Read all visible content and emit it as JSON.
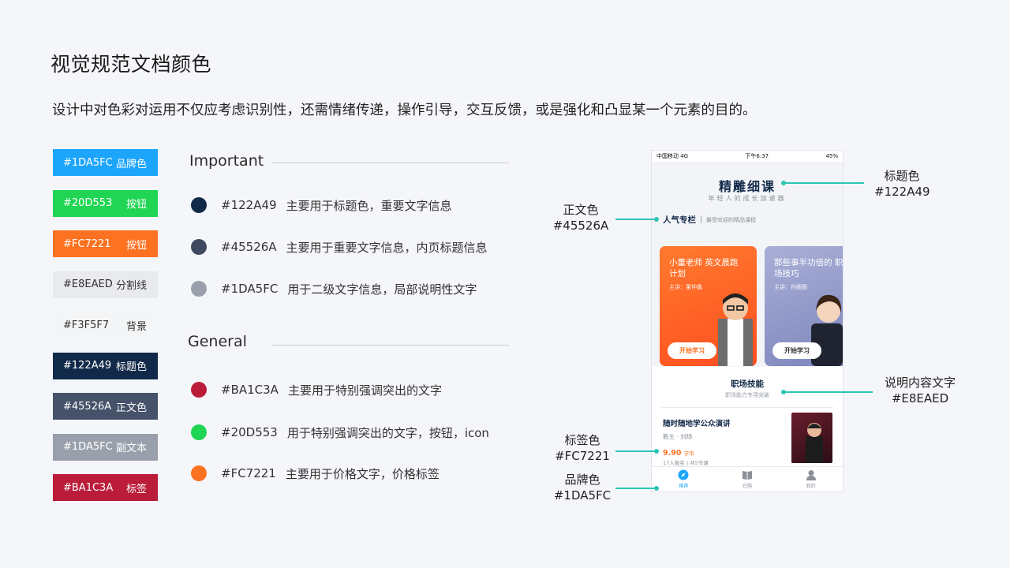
{
  "page": {
    "title": "视觉规范文档颜色",
    "subtitle": "设计中对色彩对运用不仅应考虑识别性，还需情绪传递，操作引导，交互反馈，或是强化和凸显某一个元素的目的。"
  },
  "swatches": [
    {
      "hex": "#1DA5FC",
      "label": "品牌色",
      "bg": "#1DA5FC",
      "text_color": "#ffffff"
    },
    {
      "hex": "#20D553",
      "label": "按钮",
      "bg": "#20D553",
      "text_color": "#ffffff"
    },
    {
      "hex": "#FC7221",
      "label": "按钮",
      "bg": "#FC7221",
      "text_color": "#ffffff"
    },
    {
      "hex": "#E8EAED",
      "label": "分割线",
      "bg": "#E8EAED",
      "text_color": "#333333"
    },
    {
      "hex": "#F3F5F7",
      "label": "背景",
      "bg": "#F3F5F7",
      "text_color": "#333333"
    },
    {
      "hex": "#122A49",
      "label": "标题色",
      "bg": "#122A49",
      "text_color": "#ffffff"
    },
    {
      "hex": "#45526A",
      "label": "正文色",
      "bg": "#45526A",
      "text_color": "#ffffff"
    },
    {
      "hex": "#1DA5FC",
      "label": "副文本",
      "bg": "#9AA0AB",
      "text_color": "#ffffff"
    },
    {
      "hex": "#BA1C3A",
      "label": "标签",
      "bg": "#BA1C3A",
      "text_color": "#ffffff"
    }
  ],
  "important": {
    "heading": "Important",
    "items": [
      {
        "hex": "#122A49",
        "desc": "主要用于标题色，重要文字信息",
        "dot": "#122A49"
      },
      {
        "hex": "#45526A",
        "desc": "主要用于重要文字信息，内页标题信息",
        "dot": "#3f4a60"
      },
      {
        "hex": "#1DA5FC",
        "desc": "用于二级文字信息，局部说明性文字",
        "dot": "#9aa0ab"
      }
    ]
  },
  "general": {
    "heading": "General",
    "items": [
      {
        "hex": "#BA1C3A",
        "desc": "主要用于特别强调突出的文字",
        "dot": "#BA1C3A"
      },
      {
        "hex": "#20D553",
        "desc": "用于特别强调突出的文字，按钮，icon",
        "dot": "#20D553"
      },
      {
        "hex": "#FC7221",
        "desc": "主要用于价格文字，价格标签",
        "dot": "#FC7221"
      }
    ]
  },
  "phone": {
    "status_left": "中国移动  4G",
    "status_time": "下午6:37",
    "status_right": "45%",
    "app_title": "精雕细课",
    "app_slogan": "年轻人的成长加速器",
    "column_name": "人气专栏",
    "column_desc": "最受欢迎的精品课程",
    "cards": [
      {
        "title": "小董老师 英文晨跑计划",
        "lecturer": "主讲：董仲蠡",
        "button": "开始学习"
      },
      {
        "title": "那些事半功倍的 职场技巧",
        "lecturer": "主讲：孙圈圈",
        "button": "开始学习"
      }
    ],
    "skill_title": "职场技能",
    "skill_subtitle": "职场能力专项突破",
    "course": {
      "title": "随时随地学公众演讲",
      "teacher": "教主 · 刘旸",
      "price": "9.90",
      "price_unit": "学币",
      "meta": "17人报名 | 共5节课"
    },
    "tabs": [
      {
        "label": "推荐",
        "icon": "compass-icon",
        "active": true
      },
      {
        "label": "已购",
        "icon": "book-icon",
        "active": false
      },
      {
        "label": "我的",
        "icon": "user-icon",
        "active": false
      }
    ]
  },
  "callouts": {
    "title_color": {
      "label": "标题色",
      "hex": "#122A49"
    },
    "body_color": {
      "label": "正文色",
      "hex": "#45526A"
    },
    "desc_text": {
      "label": "说明内容文字",
      "hex": "#E8EAED"
    },
    "tag_color": {
      "label": "标签色",
      "hex": "#FC7221"
    },
    "brand_color": {
      "label": "品牌色",
      "hex": "#1DA5FC"
    }
  }
}
